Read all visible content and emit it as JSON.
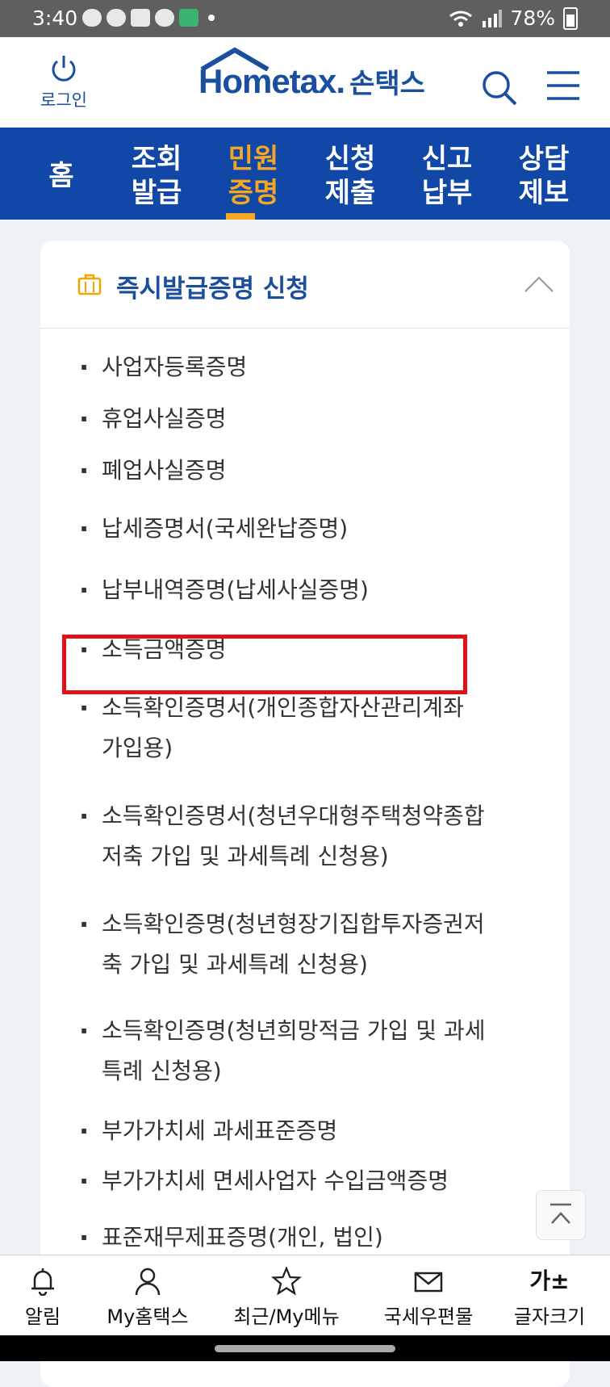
{
  "status_bar": {
    "time": "3:40",
    "battery": "78%",
    "notif_icons": [
      "talk-icon",
      "talk-icon",
      "n-icon",
      "chat-icon",
      "all-icon"
    ]
  },
  "header": {
    "login_label": "로그인",
    "logo_home": "Hometax.",
    "logo_son": "손택스"
  },
  "nav": {
    "items": [
      {
        "label1": "홈",
        "label2": ""
      },
      {
        "label1": "조회",
        "label2": "발급"
      },
      {
        "label1": "민원",
        "label2": "증명"
      },
      {
        "label1": "신청",
        "label2": "제출"
      },
      {
        "label1": "신고",
        "label2": "납부"
      },
      {
        "label1": "상담",
        "label2": "제보"
      }
    ],
    "active_color": "#f5a623",
    "bg_color": "#1147a6"
  },
  "section": {
    "title": "즉시발급증명 신청",
    "items": [
      "사업자등록증명",
      "휴업사실증명",
      "폐업사실증명",
      "납세증명서(국세완납증명)",
      "납부내역증명(납세사실증명)",
      "소득금액증명",
      "소득확인증명서(개인종합자산관리계좌",
      "가입용)",
      "소득확인증명서(청년우대형주택청약종합",
      "저축 가입 및 과세특례 신청용)",
      "소득확인증명(청년형장기집합투자증권저",
      "축 가입 및 과세특례 신청용)",
      "소득확인증명(청년희망적금 가입 및 과세",
      "특례 신청용)",
      "부가가치세 과세표준증명",
      "부가가치세 면세사업자 수입금액증명",
      "표준재무제표증명(개인, 법인)"
    ],
    "highlight_color": "#e3101a"
  },
  "tabbar": {
    "items": [
      "알림",
      "My홈택스",
      "최근/My메뉴",
      "국세우편물",
      "글자크기"
    ],
    "font_glyph": "가±"
  }
}
